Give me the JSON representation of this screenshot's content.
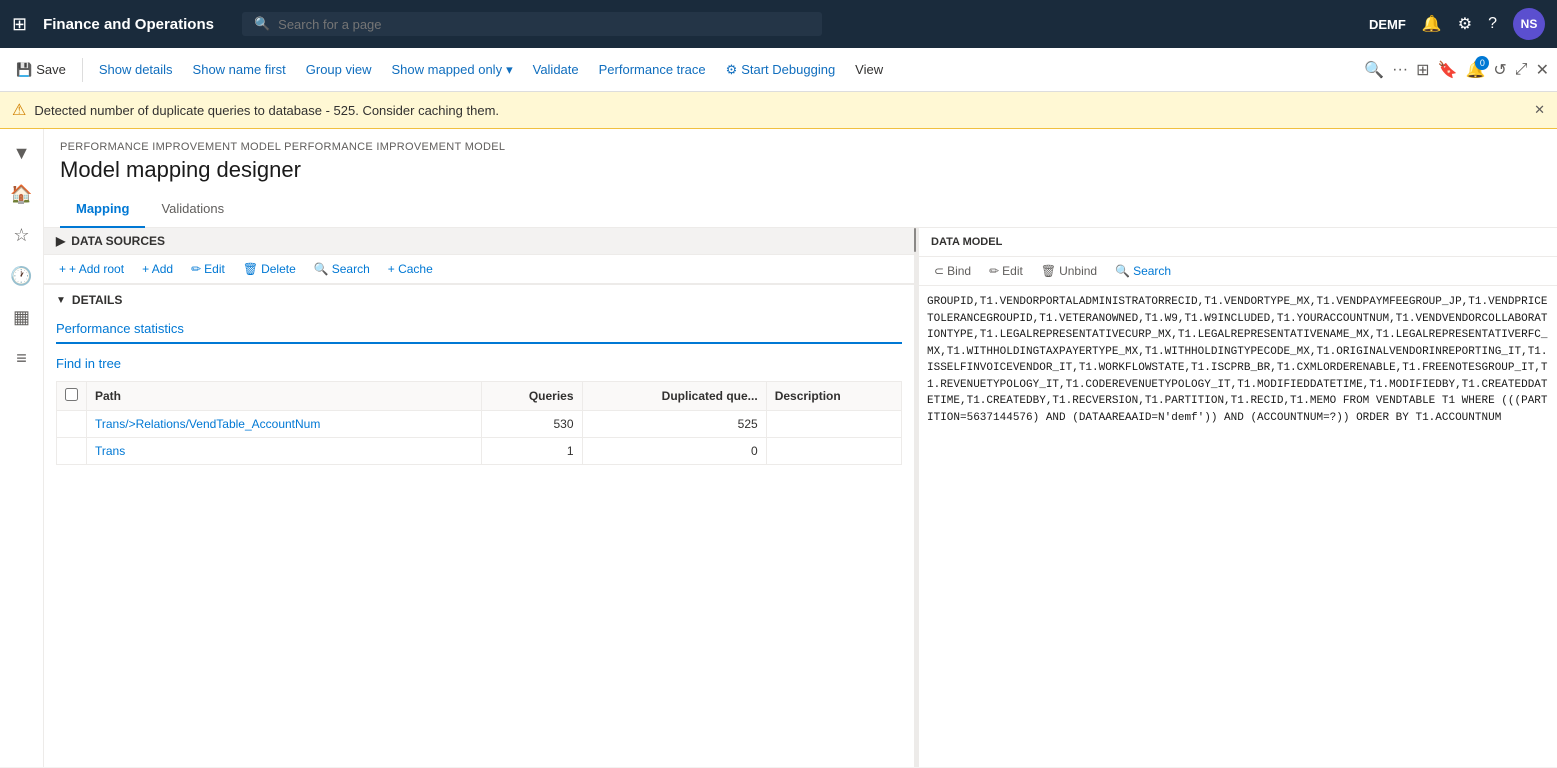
{
  "topNav": {
    "appTitle": "Finance and Operations",
    "searchPlaceholder": "Search for a page",
    "userCode": "DEMF",
    "avatarText": "NS"
  },
  "toolbar": {
    "saveLabel": "Save",
    "showDetailsLabel": "Show details",
    "showNameFirstLabel": "Show name first",
    "groupViewLabel": "Group view",
    "showMappedOnlyLabel": "Show mapped only",
    "validateLabel": "Validate",
    "performanceTraceLabel": "Performance trace",
    "startDebuggingLabel": "Start Debugging",
    "viewLabel": "View",
    "badgeCount": "0"
  },
  "warningBanner": {
    "message": "Detected number of duplicate queries to database - 525. Consider caching them."
  },
  "breadcrumb": "PERFORMANCE IMPROVEMENT MODEL PERFORMANCE IMPROVEMENT MODEL",
  "pageTitle": "Model mapping designer",
  "tabs": {
    "mapping": "Mapping",
    "validations": "Validations"
  },
  "dataSourcesSection": {
    "label": "DATA SOURCES",
    "addRootLabel": "+ Add root",
    "addLabel": "+ Add",
    "editLabel": "Edit",
    "deleteLabel": "Delete",
    "searchLabel": "Search",
    "cacheLabel": "+ Cache"
  },
  "detailsSection": {
    "label": "DETAILS",
    "perfStatsTab": "Performance statistics",
    "findInTree": "Find in tree",
    "tableHeaders": {
      "check": "",
      "path": "Path",
      "queries": "Queries",
      "duplicatedQue": "Duplicated que...",
      "description": "Description"
    },
    "tableRows": [
      {
        "path": "Trans/>Relations/VendTable_AccountNum",
        "queries": "530",
        "duplicated": "525",
        "description": ""
      },
      {
        "path": "Trans",
        "queries": "1",
        "duplicated": "0",
        "description": ""
      }
    ]
  },
  "dataModel": {
    "label": "DATA MODEL",
    "bindLabel": "Bind",
    "editLabel": "Edit",
    "unbindLabel": "Unbind",
    "searchLabel": "Search"
  },
  "sqlContent": "GROUPID,T1.VENDORPORTALADMINISTRATORRECID,T1.VENDORTYPE_MX,T1.VENDPAYMFEEGROUP_JP,T1.VENDPRICETOLERANCEGROUPID,T1.VETERANOWNED,T1.W9,T1.W9INCLUDED,T1.YOURACCOUNTNUM,T1.VENDVENDORCOLLABORATIONTYPE,T1.LEGALREPRESENTATIVECURP_MX,T1.LEGALREPRESENTATIVENAME_MX,T1.LEGALREPRESENTATIVERFC_MX,T1.WITHHOLDINGTAXPAYERTYPE_MX,T1.WITHHOLDINGTYPECODE_MX,T1.ORIGINALVENDORINREPORTING_IT,T1.ISSELFINVOICEVENDOR_IT,T1.WORKFLOWSTATE,T1.ISCPRB_BR,T1.CXMLORDERENABLE,T1.FREENOTESGROUP_IT,T1.REVENUETYPOLOGY_IT,T1.CODEREVENUETYPOLOGY_IT,T1.MODIFIEDDATETIME,T1.MODIFIEDBY,T1.CREATEDDATETIME,T1.CREATEDBY,T1.RECVERSION,T1.PARTITION,T1.RECID,T1.MEMO FROM VENDTABLE T1 WHERE (((PARTITION=5637144576) AND (DATAAREAAID=N'demf')) AND (ACCOUNTNUM=?)) ORDER BY T1.ACCOUNTNUM"
}
